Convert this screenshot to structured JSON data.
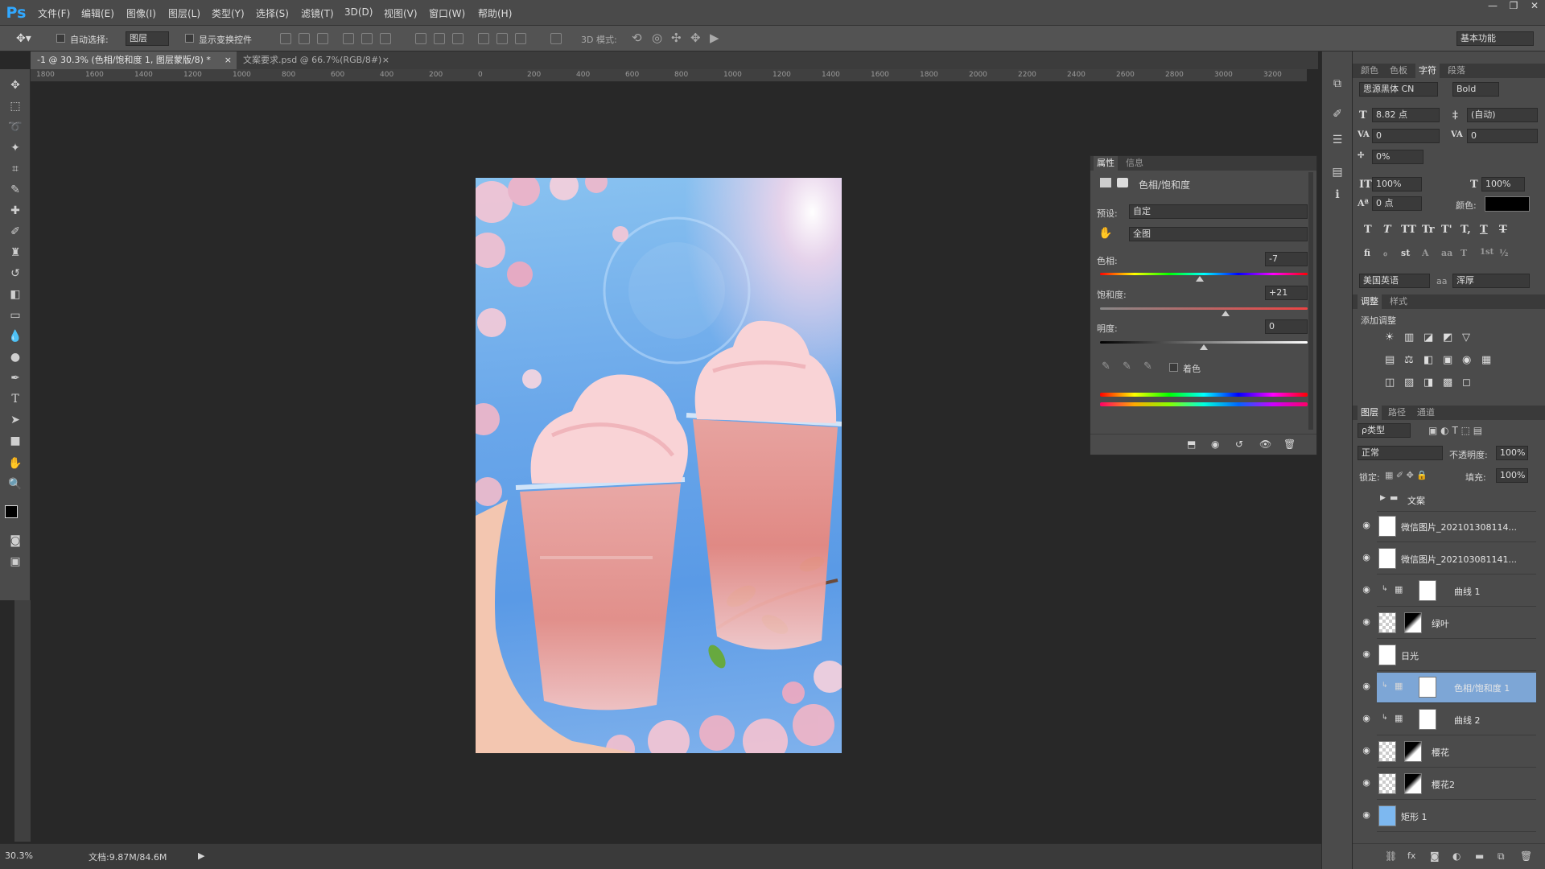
{
  "menubar": {
    "logo": "Ps",
    "items": [
      "文件(F)",
      "编辑(E)",
      "图像(I)",
      "图层(L)",
      "类型(Y)",
      "选择(S)",
      "滤镜(T)",
      "3D(D)",
      "视图(V)",
      "窗口(W)",
      "帮助(H)"
    ],
    "window_controls": [
      "—",
      "❐",
      "✕"
    ]
  },
  "options": {
    "auto_select_label": "自动选择:",
    "auto_select_value": "图层",
    "show_transform_label": "显示变换控件",
    "mode3d_label": "3D 模式:",
    "workspace": "基本功能"
  },
  "tabs": [
    {
      "label": "-1 @ 30.3% (色相/饱和度 1, 图层蒙版/8) *",
      "close": "×"
    },
    {
      "label": "文案要求.psd @ 66.7%(RGB/8#)",
      "close": "×"
    }
  ],
  "ruler_h": [
    "1800",
    "1600",
    "1400",
    "1200",
    "1000",
    "800",
    "600",
    "400",
    "200",
    "0",
    "200",
    "400",
    "600",
    "800",
    "1000",
    "1200",
    "1400",
    "1600",
    "1800",
    "2000",
    "2200",
    "2400",
    "2600",
    "2800",
    "3000",
    "3200"
  ],
  "status": {
    "zoom": "30.3%",
    "doc": "文档:9.87M/84.6M",
    "arrow": "▶"
  },
  "properties": {
    "tabs": [
      "属性",
      "信息"
    ],
    "title": "色相/饱和度",
    "preset_label": "预设:",
    "preset_value": "自定",
    "channel_value": "全图",
    "hue_label": "色相:",
    "hue_value": "-7",
    "saturation_label": "饱和度:",
    "saturation_value": "+21",
    "lightness_label": "明度:",
    "lightness_value": "0",
    "colorize_label": "着色",
    "hue_level": -7,
    "saturation_level": 21,
    "lightness_level": 0
  },
  "character": {
    "tabs": [
      "颜色",
      "色板",
      "字符",
      "段落"
    ],
    "font_family": "思源黑体 CN",
    "font_style": "Bold",
    "font_size": "8.82 点",
    "leading": "(自动)",
    "kerning": "0",
    "tracking": "0",
    "scale_pct": "0%",
    "vert_scale": "100%",
    "horiz_scale": "100%",
    "baseline": "0 点",
    "color_label": "颜色:",
    "language": "美国英语",
    "aa_label": "aa",
    "antialias": "浑厚",
    "type_buttons": [
      "T",
      "T",
      "TT",
      "Tr",
      "T'",
      "T,",
      "T",
      "T"
    ],
    "ot_buttons": [
      "fi",
      "ℴ",
      "st",
      "A",
      "aa",
      "T",
      "1st",
      "½"
    ]
  },
  "adjustments": {
    "tabs": [
      "调整",
      "样式"
    ],
    "title": "添加调整"
  },
  "layers": {
    "tabs": [
      "图层",
      "路径",
      "通道"
    ],
    "filter_value": "ρ类型",
    "blend_mode": "正常",
    "opacity_label": "不透明度:",
    "opacity_value": "100%",
    "lock_label": "锁定:",
    "fill_label": "填充:",
    "fill_value": "100%",
    "items": [
      {
        "name": "文案",
        "type": "group"
      },
      {
        "name": "微信图片_202101308114...",
        "type": "smart"
      },
      {
        "name": "微信图片_202103081141...",
        "type": "smart"
      },
      {
        "name": "曲线 1",
        "type": "adjust"
      },
      {
        "name": "绿叶",
        "type": "masked"
      },
      {
        "name": "日光",
        "type": "smart"
      },
      {
        "name": "色相/饱和度 1",
        "type": "adjust",
        "selected": true
      },
      {
        "name": "曲线 2",
        "type": "adjust"
      },
      {
        "name": "樱花",
        "type": "masked"
      },
      {
        "name": "樱花2",
        "type": "masked"
      },
      {
        "name": "矩形 1",
        "type": "shape"
      }
    ]
  },
  "colors": {
    "accent": "#7da6d6",
    "menubar": "#4a4a4a",
    "panel": "#4b4b4b"
  }
}
